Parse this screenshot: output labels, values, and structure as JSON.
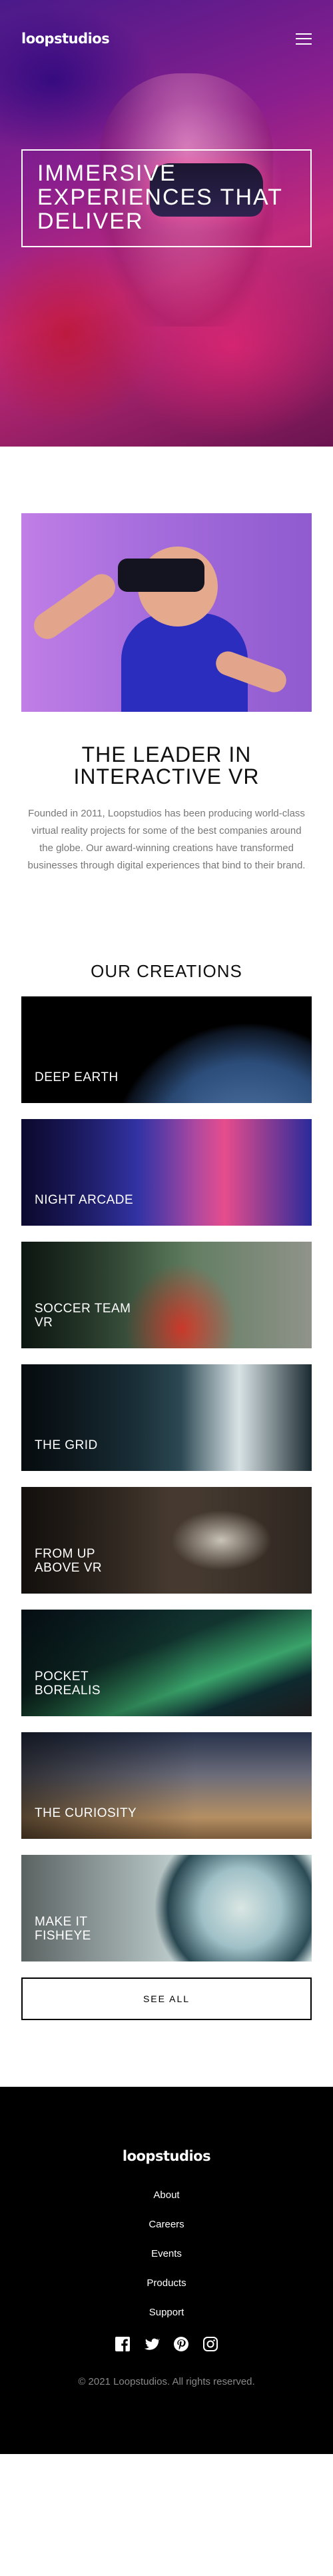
{
  "brand": {
    "logo": "loopstudios"
  },
  "hero": {
    "headline": "Immersive experiences that deliver"
  },
  "interactive": {
    "heading": "The leader in interactive VR",
    "body": "Founded in 2011, Loopstudios has been producing world-class virtual reality projects for some of the best companies around the globe. Our award-winning creations have transformed businesses through digital experiences that bind to their brand."
  },
  "creations": {
    "heading": "Our creations",
    "items": [
      {
        "title": "Deep Earth"
      },
      {
        "title": "Night Arcade"
      },
      {
        "title": "Soccer Team VR"
      },
      {
        "title": "The Grid"
      },
      {
        "title": "From Up Above VR"
      },
      {
        "title": "Pocket Borealis"
      },
      {
        "title": "The Curiosity"
      },
      {
        "title": "Make It Fisheye"
      }
    ],
    "see_all": "See all"
  },
  "footer": {
    "logo": "loopstudios",
    "links": [
      "About",
      "Careers",
      "Events",
      "Products",
      "Support"
    ],
    "social": [
      "facebook-icon",
      "twitter-icon",
      "pinterest-icon",
      "instagram-icon"
    ],
    "copyright": "© 2021 Loopstudios. All rights reserved."
  }
}
